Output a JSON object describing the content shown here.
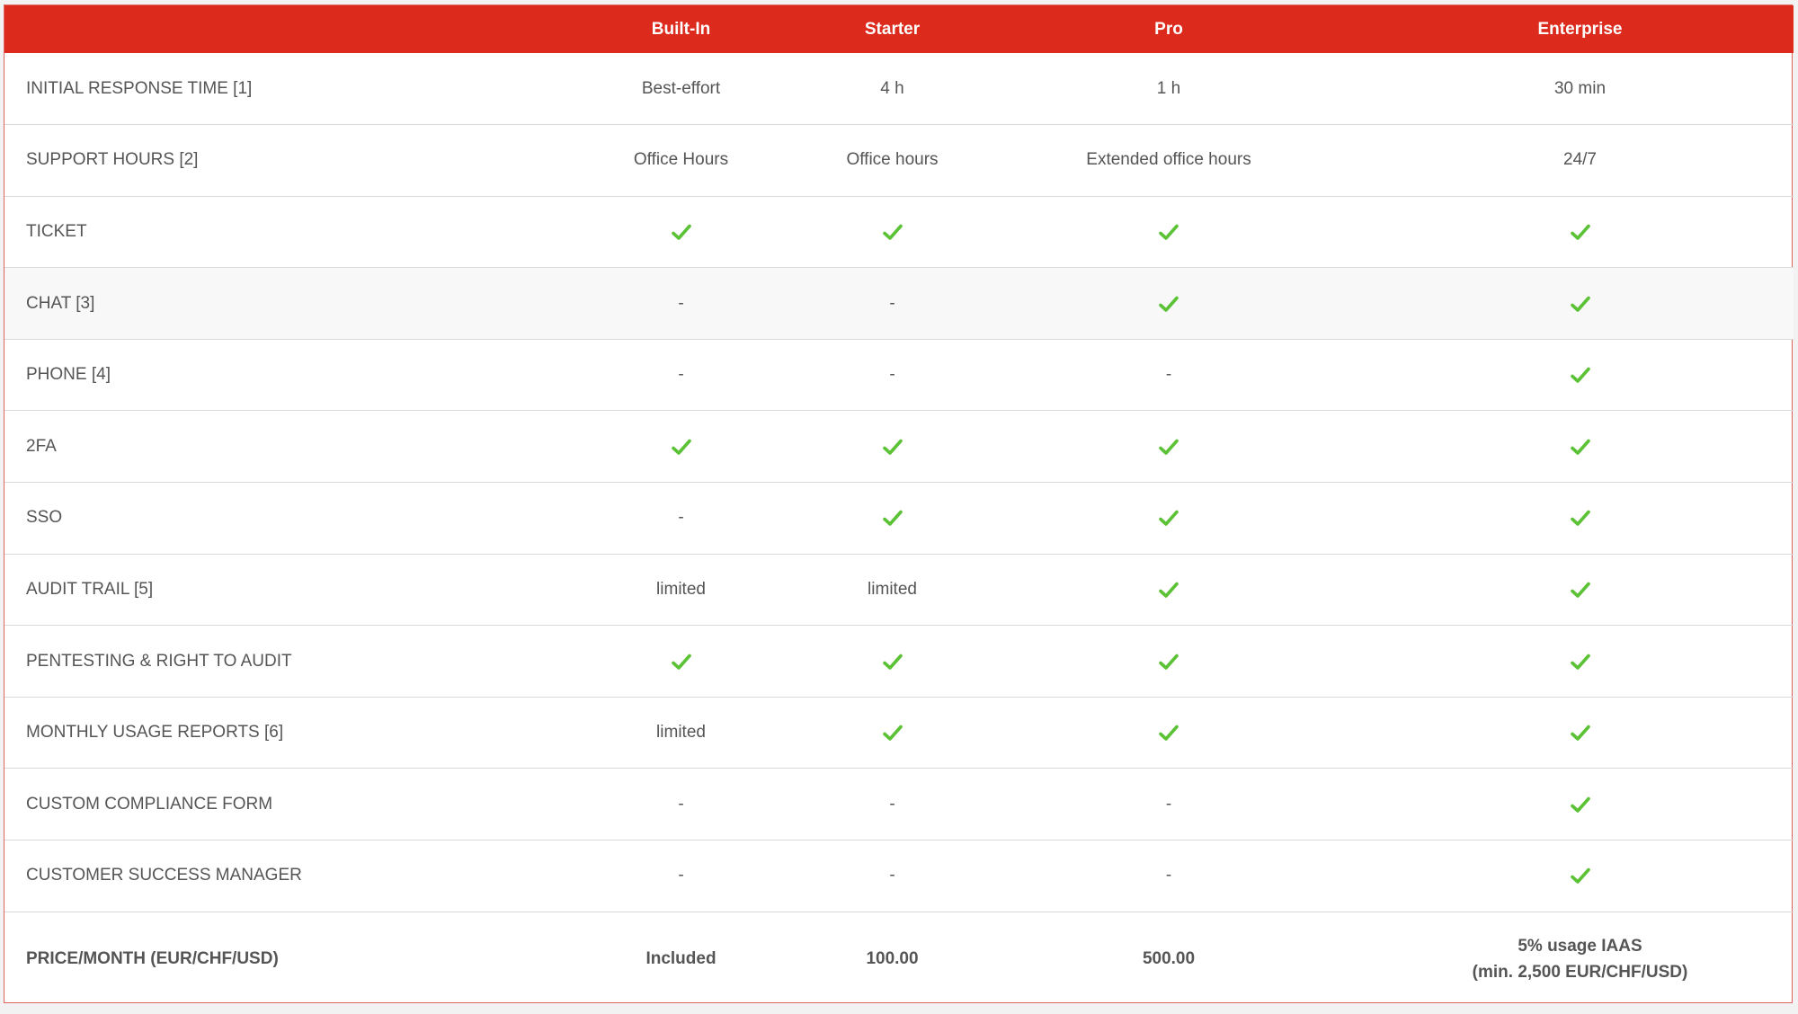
{
  "colors": {
    "accent": "#dc2a1c",
    "check": "#5bc236",
    "text": "#555555"
  },
  "header": {
    "corner": "",
    "plans": [
      "Built-In",
      "Starter",
      "Pro",
      "Enterprise"
    ]
  },
  "rows": [
    {
      "feature": "INITIAL RESPONSE TIME [1]",
      "cells": [
        "Best-effort",
        "4 h",
        "1 h",
        "30 min"
      ]
    },
    {
      "feature": "SUPPORT HOURS [2]",
      "cells": [
        "Office Hours",
        "Office hours",
        "Extended office hours",
        "24/7"
      ]
    },
    {
      "feature": "TICKET",
      "cells": [
        "check",
        "check",
        "check",
        "check"
      ]
    },
    {
      "feature": "CHAT [3]",
      "cells": [
        "-",
        "-",
        "check",
        "check"
      ]
    },
    {
      "feature": "PHONE [4]",
      "cells": [
        "-",
        "-",
        "-",
        "check"
      ]
    },
    {
      "feature": "2FA",
      "cells": [
        "check",
        "check",
        "check",
        "check"
      ]
    },
    {
      "feature": "SSO",
      "cells": [
        "-",
        "check",
        "check",
        "check"
      ]
    },
    {
      "feature": "AUDIT TRAIL [5]",
      "cells": [
        "limited",
        "limited",
        "check",
        "check"
      ]
    },
    {
      "feature": "PENTESTING & RIGHT TO AUDIT",
      "cells": [
        "check",
        "check",
        "check",
        "check"
      ]
    },
    {
      "feature": "MONTHLY USAGE REPORTS [6]",
      "cells": [
        "limited",
        "check",
        "check",
        "check"
      ]
    },
    {
      "feature": "CUSTOM COMPLIANCE FORM",
      "cells": [
        "-",
        "-",
        "-",
        "check"
      ]
    },
    {
      "feature": "CUSTOMER SUCCESS MANAGER",
      "cells": [
        "-",
        "-",
        "-",
        "check"
      ]
    }
  ],
  "price_row": {
    "feature": "PRICE/MONTH (EUR/CHF/USD)",
    "builtin": "Included",
    "starter": "100.00",
    "pro": "500.00",
    "enterprise_line1": "5% usage IAAS",
    "enterprise_line2": "(min. 2,500 EUR/CHF/USD)"
  }
}
